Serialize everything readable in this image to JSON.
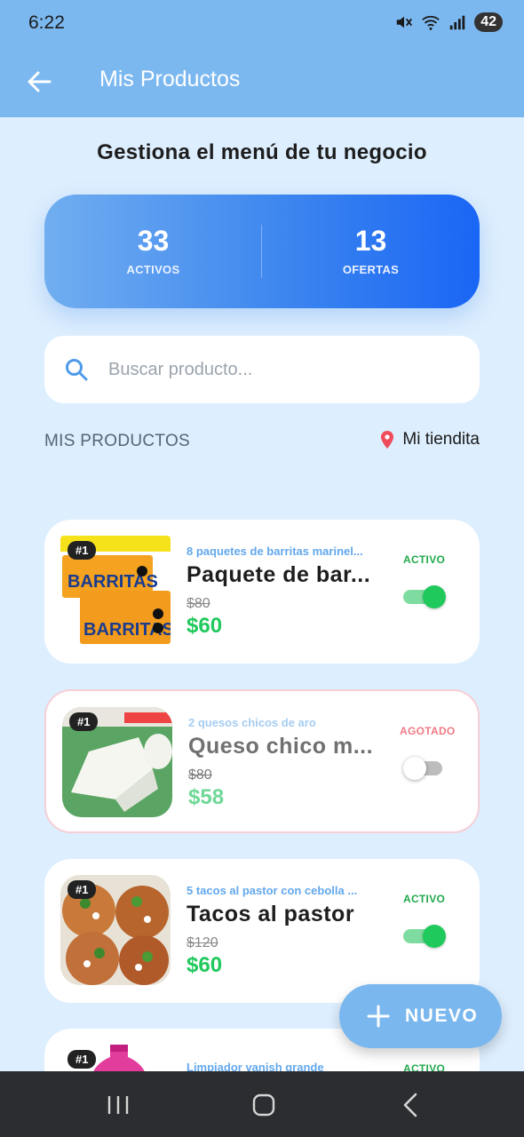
{
  "status_bar": {
    "time": "6:22",
    "battery": "42"
  },
  "app_bar": {
    "title": "Mis Productos"
  },
  "heading": "Gestiona el menú de tu negocio",
  "stats": [
    {
      "value": "33",
      "label": "ACTIVOS"
    },
    {
      "value": "13",
      "label": "OFERTAS"
    }
  ],
  "search": {
    "placeholder": "Buscar producto..."
  },
  "section": {
    "title": "MIS PRODUCTOS",
    "store": "Mi tiendita"
  },
  "products": [
    {
      "rank": "#1",
      "description": "8 paquetes de barritas marinel...",
      "name": "Paquete de bar...",
      "old_price": "$80",
      "price": "$60",
      "status": "ACTIVO",
      "enabled": true,
      "image": "barritas-package"
    },
    {
      "rank": "#1",
      "description": "2 quesos chicos de aro",
      "name": "Queso chico m...",
      "old_price": "$80",
      "price": "$58",
      "status": "AGOTADO",
      "enabled": false,
      "image": "cheese"
    },
    {
      "rank": "#1",
      "description": "5 tacos al pastor con cebolla ...",
      "name": "Tacos al pastor",
      "old_price": "$120",
      "price": "$60",
      "status": "ACTIVO",
      "enabled": true,
      "image": "tacos"
    },
    {
      "rank": "#1",
      "description": "Limpiador vanish grande",
      "status": "ACTIVO",
      "enabled": true,
      "image": "vanish-bottle"
    }
  ],
  "fab": {
    "label": "NUEVO"
  },
  "colors": {
    "primary": "#7cb8f0",
    "accent_green": "#1fc95c",
    "sold_out_red": "#f07a86",
    "background": "#ddeefe"
  }
}
